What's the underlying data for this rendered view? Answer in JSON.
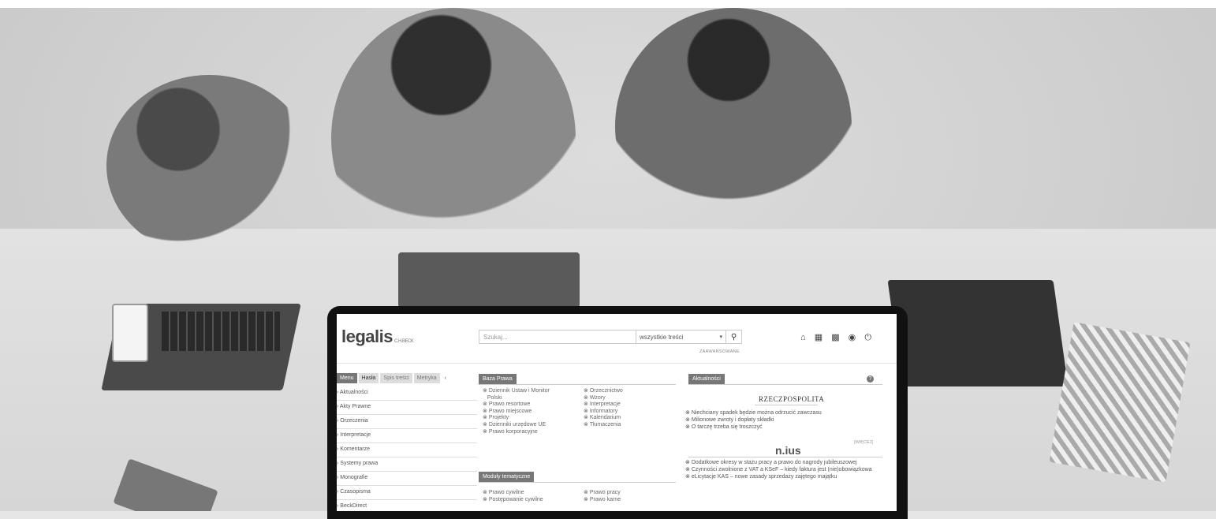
{
  "header": {
    "logo": "legalis",
    "logo_sub": "C.H.BECK",
    "search_placeholder": "Szukaj...",
    "scope": "wszystkie treści",
    "search_icon": "search-icon",
    "advanced": "ZAAWANSOWANE",
    "icons": [
      "home-icon",
      "calendar-icon",
      "briefcase-icon",
      "user-icon",
      "power-icon"
    ]
  },
  "left": {
    "tabs": [
      "Menu",
      "Hasła",
      "Spis treści",
      "Metryka"
    ],
    "collapse": "‹",
    "items": [
      "Aktualności",
      "Akty Prawne",
      "Orzeczenia",
      "Interpretacje",
      "Komentarze",
      "Systemy prawa",
      "Monografie",
      "Czasopisma",
      "BeckDirect"
    ]
  },
  "baza": {
    "title": "Baza Prawa",
    "col1": [
      "Dziennik Ustaw i Monitor",
      "Polski",
      "Prawo resortowe",
      "Prawo miejscowe",
      "Projekty",
      "Dzienniki urzędowe UE",
      "Prawo korporacyjne"
    ],
    "col2": [
      "Orzecznictwo",
      "Wzory",
      "Interpretacje",
      "Informatory",
      "Kalendarium",
      "Tłumaczenia"
    ]
  },
  "moduly": {
    "title": "Moduły tematyczne",
    "col1": [
      "Prawo cywilne",
      "Postępowanie cywilne"
    ],
    "col2": [
      "Prawo pracy",
      "Prawo karne"
    ]
  },
  "news": {
    "title": "Aktualności",
    "help": "?",
    "source1": "RZECZPOSPOLITA",
    "items1": [
      "Niechciany spadek będzie można odrzucić zawczasu",
      "Milionowe zwroty i dopłaty składki",
      "O tarczę trzeba się troszczyć"
    ],
    "more": "[WIĘCEJ]",
    "source2": "n.ius",
    "items2": [
      "Dodatkowe okresy w stażu pracy a prawo do nagrody jubileuszowej",
      "Czynności zwolnione z VAT a KSeF – kiedy faktura jest (nie)obowiązkowa",
      "eLicytacje KAS – nowe zasady sprzedaży zajętego majątku"
    ]
  }
}
